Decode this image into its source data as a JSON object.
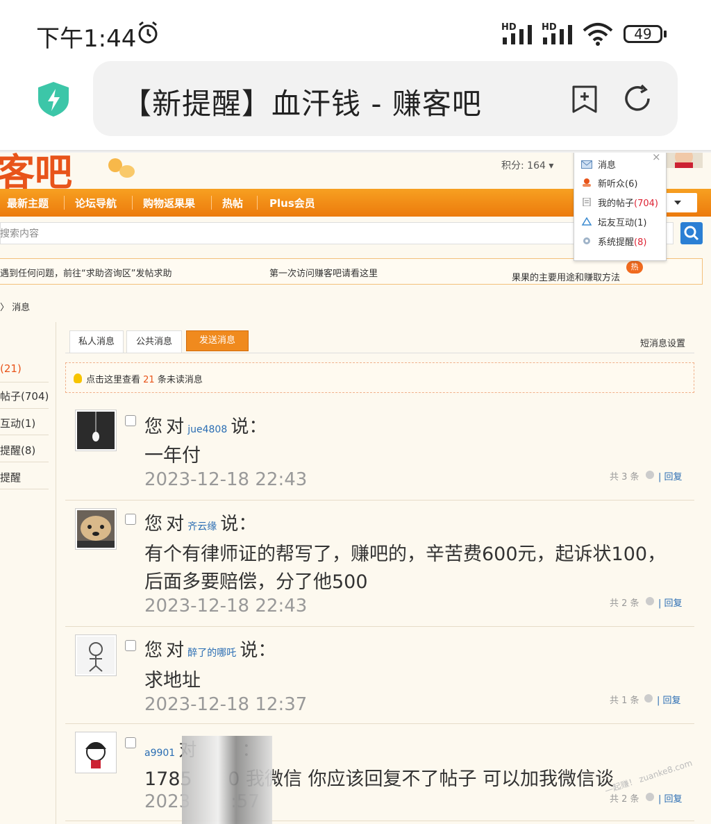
{
  "status": {
    "time": "下午1:44",
    "hd1": "HD",
    "hd2": "HD",
    "battery": "49"
  },
  "address": {
    "title": "【新提醒】血汗钱 - 赚客吧"
  },
  "site": {
    "logo": "客吧",
    "points": "积分: 164 ▾",
    "nav": [
      "最新主题",
      "论坛导航",
      "购物返果果",
      "热帖",
      "Plus会员"
    ],
    "search_placeholder": "搜索内容",
    "notice": [
      "遇到任何问题，前往“求助咨询区”发帖求助",
      "第一次访问赚客吧请看这里",
      "果果的主要用途和赚取方法"
    ],
    "hot": "热",
    "breadcrumb": "〉 消息"
  },
  "dropdown": {
    "close": "×",
    "items": [
      {
        "label": "消息",
        "count": ""
      },
      {
        "label": "新听众(6)",
        "count": ""
      },
      {
        "label": "我的帖子",
        "count": "(704)"
      },
      {
        "label": "坛友互动(1)",
        "count": ""
      },
      {
        "label": "系统提醒",
        "count": "(8)"
      }
    ]
  },
  "sidebar": {
    "items": [
      "(21)",
      "帖子(704)",
      "互动(1)",
      "提醒(8)",
      "提醒"
    ]
  },
  "tabs": {
    "private": "私人消息",
    "public": "公共消息",
    "send": "发送消息",
    "settings": "短消息设置"
  },
  "unread": {
    "pre": "点击这里查看",
    "count": "21",
    "post": "条未读消息"
  },
  "messages": [
    {
      "you": "您",
      "to": "对",
      "user": "jue4808",
      "said": "说：",
      "lines": [
        "一年付"
      ],
      "date": "2023-12-18 22:43",
      "count": "共 3 条",
      "reply": "回复"
    },
    {
      "you": "您",
      "to": "对",
      "user": "齐云缘",
      "said": "说：",
      "lines": [
        "有个有律师证的帮写了，赚吧的，辛苦费600元，起诉状100，",
        "后面多要赔偿，分了他500"
      ],
      "date": "2023-12-18 22:43",
      "count": "共 2 条",
      "reply": "回复"
    },
    {
      "you": "您",
      "to": "对",
      "user": "醉了的哪吒",
      "said": "说：",
      "lines": [
        "求地址"
      ],
      "date": "2023-12-18 12:37",
      "count": "共 1 条",
      "reply": "回复"
    },
    {
      "you": "",
      "to": "对",
      "user": "a9901",
      "said": "：",
      "lines": [
        "1785      0 我微信 你应该回复不了帖子 可以加我微信谈"
      ],
      "date": "2023       :57",
      "count": "共 2 条",
      "reply": "回复"
    }
  ],
  "watermark": "—起赚！ zuanke8.com",
  "colors": {
    "orange": "#ec7a0c",
    "link": "#2a6db3",
    "accent_blue": "#2b7fd4"
  }
}
